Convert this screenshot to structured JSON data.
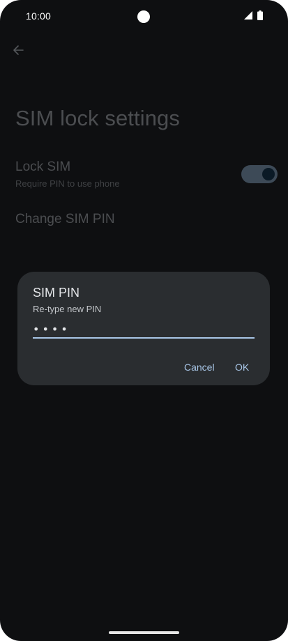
{
  "status_bar": {
    "time": "10:00"
  },
  "page": {
    "title": "SIM lock settings",
    "back_icon": "arrow-back-icon",
    "lock_sim": {
      "title": "Lock SIM",
      "subtitle": "Require PIN to use phone",
      "toggle_on": true
    },
    "change_pin": {
      "title": "Change SIM PIN"
    }
  },
  "dialog": {
    "title": "SIM PIN",
    "message": "Re-type new PIN",
    "pin_value": "••••",
    "cancel_label": "Cancel",
    "ok_label": "OK"
  },
  "colors": {
    "background": "#0e0f11",
    "dialog_bg": "#2a2d30",
    "accent": "#a9c7e8",
    "dimmed_text": "#4b4d50"
  }
}
